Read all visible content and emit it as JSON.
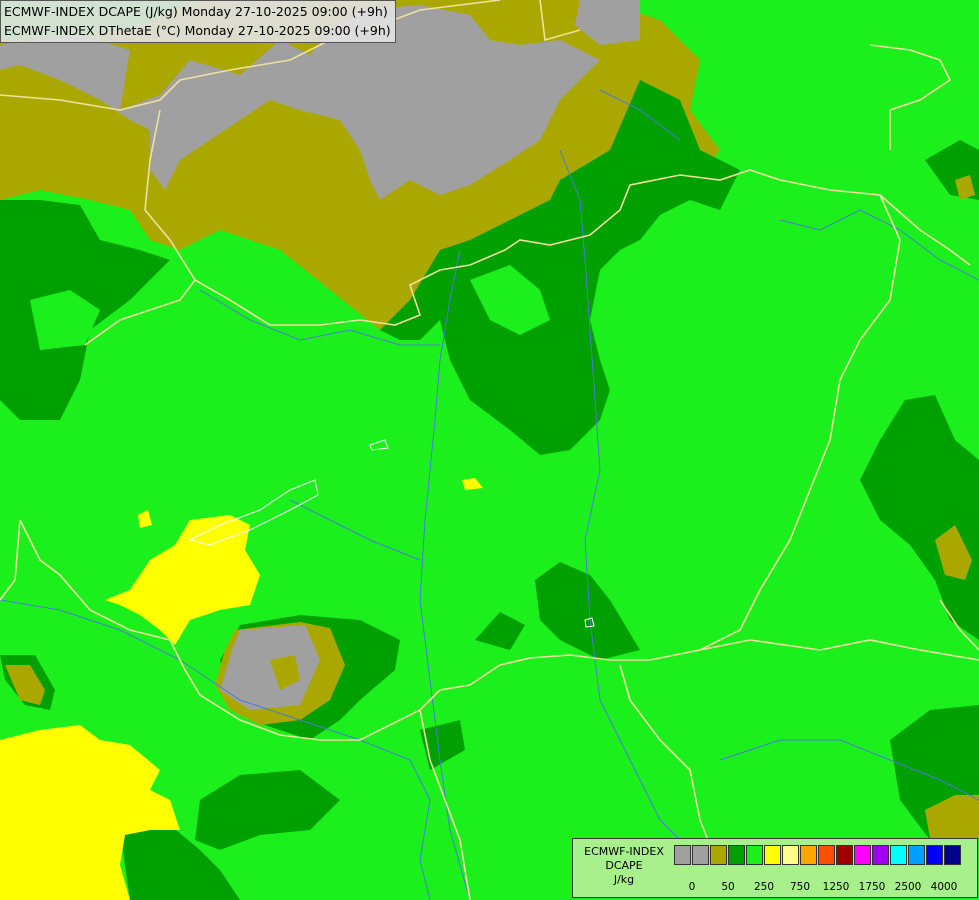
{
  "header": {
    "line1": "ECMWF-INDEX DCAPE (J/kg) Monday 27-10-2025 09:00 (+9h)",
    "line2": "ECMWF-INDEX DThetaE (°C) Monday 27-10-2025 09:00 (+9h)"
  },
  "legend": {
    "title_line1": "ECMWF-INDEX",
    "title_line2": "DCAPE",
    "units": "J/kg",
    "swatch_colors": [
      "#a0a0a0",
      "#a0a0a0",
      "#aaa800",
      "#00a000",
      "#1cf01c",
      "#ffff00",
      "#ffff88",
      "#ffa500",
      "#ff5000",
      "#a00000",
      "#ff00ff",
      "#a000f0",
      "#00ffff",
      "#00a0ff",
      "#0000ff",
      "#00008b"
    ],
    "ticks": [
      "0",
      "50",
      "250",
      "750",
      "1250",
      "1750",
      "2500",
      "4000"
    ]
  },
  "colors": {
    "gray": "#a0a0a0",
    "olive": "#aaa800",
    "dark_green": "#00a000",
    "green": "#1cf01c",
    "yellow": "#ffff00",
    "border": "#f0e0a0",
    "river": "#4a7ad8"
  }
}
